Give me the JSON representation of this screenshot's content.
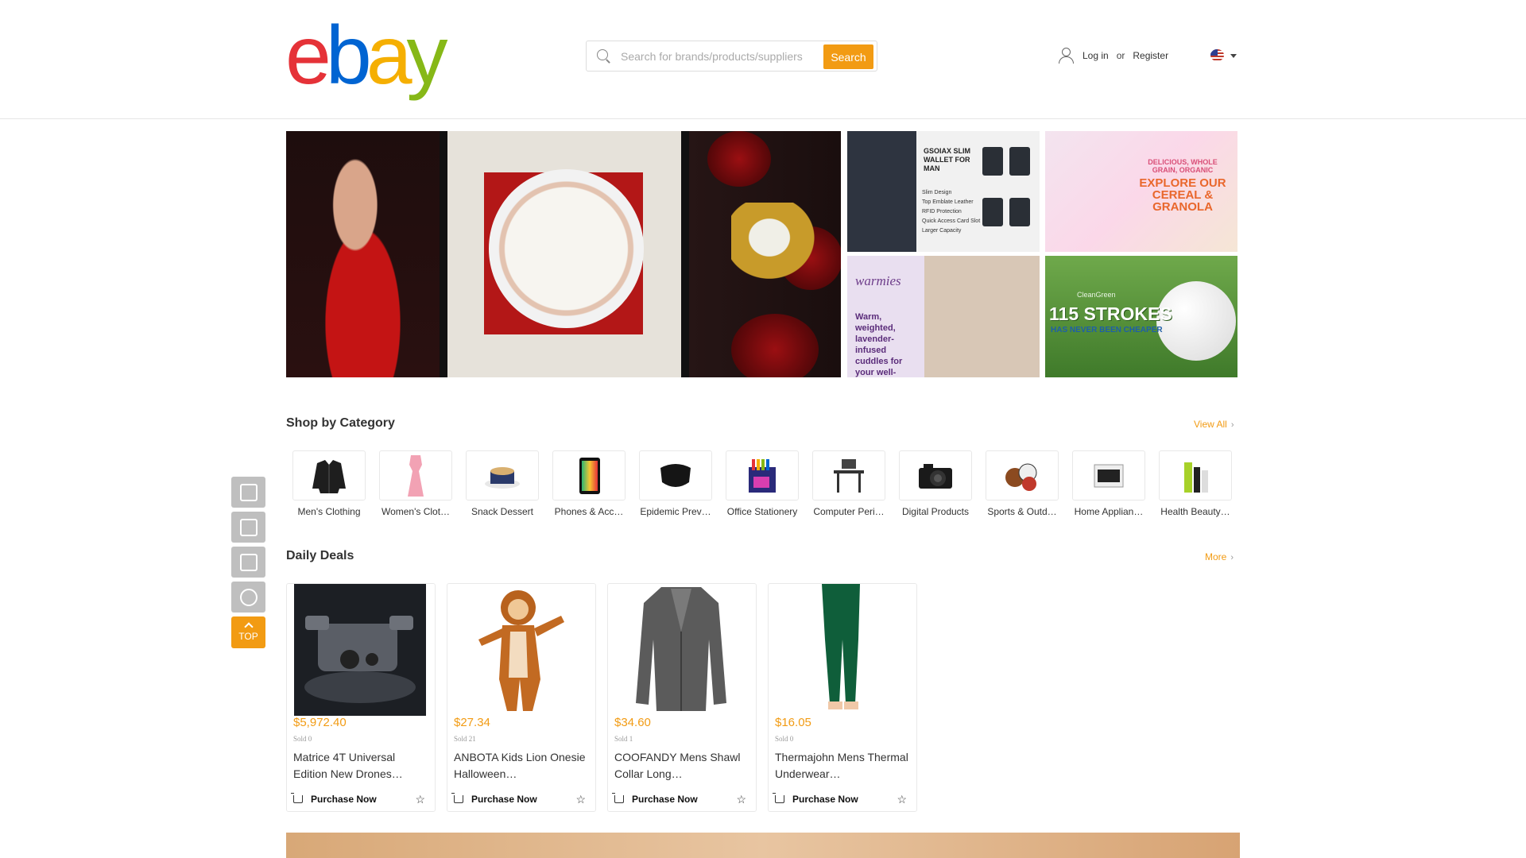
{
  "header": {
    "logo_letters": [
      "e",
      "b",
      "a",
      "y"
    ],
    "logo_colors": [
      "#e53238",
      "#0064d2",
      "#f5af02",
      "#86b817"
    ],
    "search_placeholder": "Search for brands/products/suppliers",
    "search_button": "Search",
    "login": "Log in",
    "or": "or",
    "register": "Register",
    "language_icon": "us-flag-icon"
  },
  "banners": {
    "wallet": {
      "title": "GSOIAX SLIM WALLET FOR MAN",
      "features": [
        "Slim Design",
        "Top Emblate Leather",
        "RFID Protection",
        "Quick Access Card Slot",
        "Larger Capacity"
      ]
    },
    "cereal": {
      "small": "DELICIOUS, WHOLE GRAIN, ORGANIC",
      "headline": "EXPLORE OUR CEREAL & GRANOLA"
    },
    "warmies": {
      "brand": "warmies",
      "text": "Warm, weighted, lavender-infused cuddles for your well-being"
    },
    "golf": {
      "brand": "CleanGreen",
      "headline": "115 STROKES",
      "sub": "HAS NEVER BEEN CHEAPER"
    }
  },
  "categories_section": {
    "title": "Shop by Category",
    "view_all": "View All",
    "items": [
      {
        "label": "Men's Clothing",
        "icon": "jacket-icon"
      },
      {
        "label": "Women's Clot…",
        "icon": "dress-icon"
      },
      {
        "label": "Snack Dessert",
        "icon": "cake-icon"
      },
      {
        "label": "Phones & Acc…",
        "icon": "phone-icon"
      },
      {
        "label": "Epidemic Prev…",
        "icon": "mask-icon"
      },
      {
        "label": "Office Stationery",
        "icon": "pens-icon"
      },
      {
        "label": "Computer Peri…",
        "icon": "desk-icon"
      },
      {
        "label": "Digital Products",
        "icon": "camera-icon"
      },
      {
        "label": "Sports & Outd…",
        "icon": "balls-icon"
      },
      {
        "label": "Home Applian…",
        "icon": "oven-icon"
      },
      {
        "label": "Health Beauty…",
        "icon": "bottles-icon"
      }
    ]
  },
  "deals_section": {
    "title": "Daily Deals",
    "more": "More",
    "purchase_label": "Purchase Now",
    "items": [
      {
        "price": "$5,972.40",
        "sold": "Sold 0",
        "title": "Matrice 4T Universal Edition New Drones…",
        "icon": "drone-image"
      },
      {
        "price": "$27.34",
        "sold": "Sold 21",
        "title": "ANBOTA Kids Lion Onesie Halloween…",
        "icon": "lion-costume-image"
      },
      {
        "price": "$34.60",
        "sold": "Sold 1",
        "title": "COOFANDY Mens Shawl Collar Long…",
        "icon": "cardigan-image"
      },
      {
        "price": "$16.05",
        "sold": "Sold 0",
        "title": "Thermajohn Mens Thermal Underwear…",
        "icon": "thermal-pants-image"
      }
    ]
  },
  "sidebar": {
    "buttons": [
      "new-icon",
      "thumbs-up-icon",
      "store-icon",
      "hot-icon"
    ],
    "top_label": "TOP"
  },
  "colors": {
    "accent": "#f29b13"
  }
}
